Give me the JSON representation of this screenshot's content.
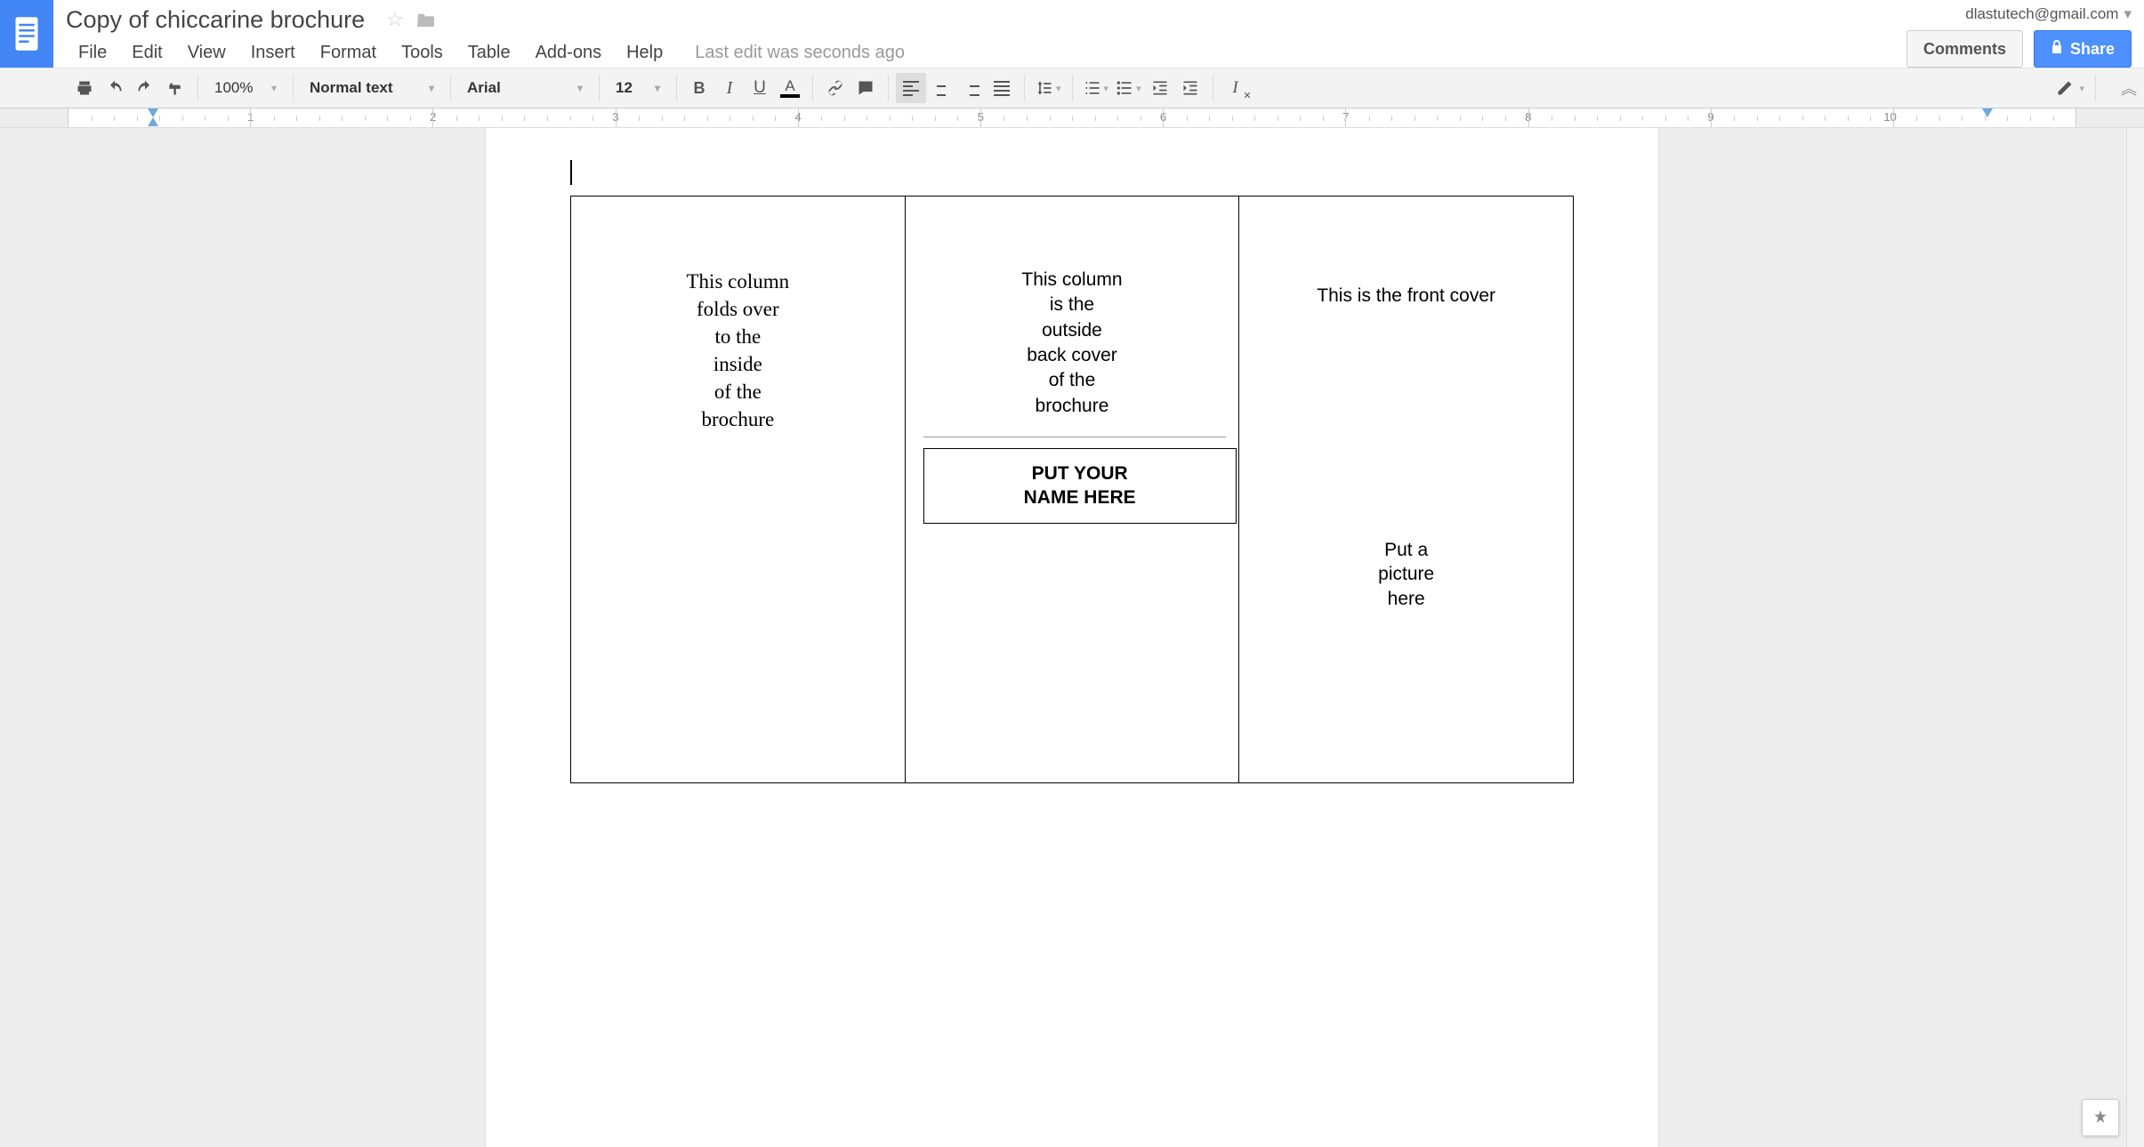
{
  "header": {
    "doc_title": "Copy of chiccarine brochure",
    "account_email": "dlastutech@gmail.com",
    "comments_label": "Comments",
    "share_label": "Share"
  },
  "menu": {
    "file": "File",
    "edit": "Edit",
    "view": "View",
    "insert": "Insert",
    "format": "Format",
    "tools": "Tools",
    "table": "Table",
    "addons": "Add-ons",
    "help": "Help",
    "last_edit": "Last edit was seconds ago"
  },
  "toolbar": {
    "zoom": "100%",
    "style": "Normal text",
    "font": "Arial",
    "font_size": "12"
  },
  "ruler": {
    "labels": [
      "1",
      "2",
      "3",
      "4",
      "5",
      "6",
      "7",
      "8",
      "9",
      "10"
    ]
  },
  "document": {
    "col1": {
      "l1": "This column",
      "l2": "folds over",
      "l3": "to the",
      "l4": "inside",
      "l5": "of the",
      "l6": "brochure"
    },
    "col2": {
      "l1": "This column",
      "l2": "is the",
      "l3": "outside",
      "l4": "back cover",
      "l5": "of the",
      "l6": "brochure",
      "name_l1": "PUT YOUR",
      "name_l2": "NAME HERE"
    },
    "col3": {
      "front": "This is the front cover",
      "pic_l1": "Put a",
      "pic_l2": "picture",
      "pic_l3": "here"
    }
  }
}
